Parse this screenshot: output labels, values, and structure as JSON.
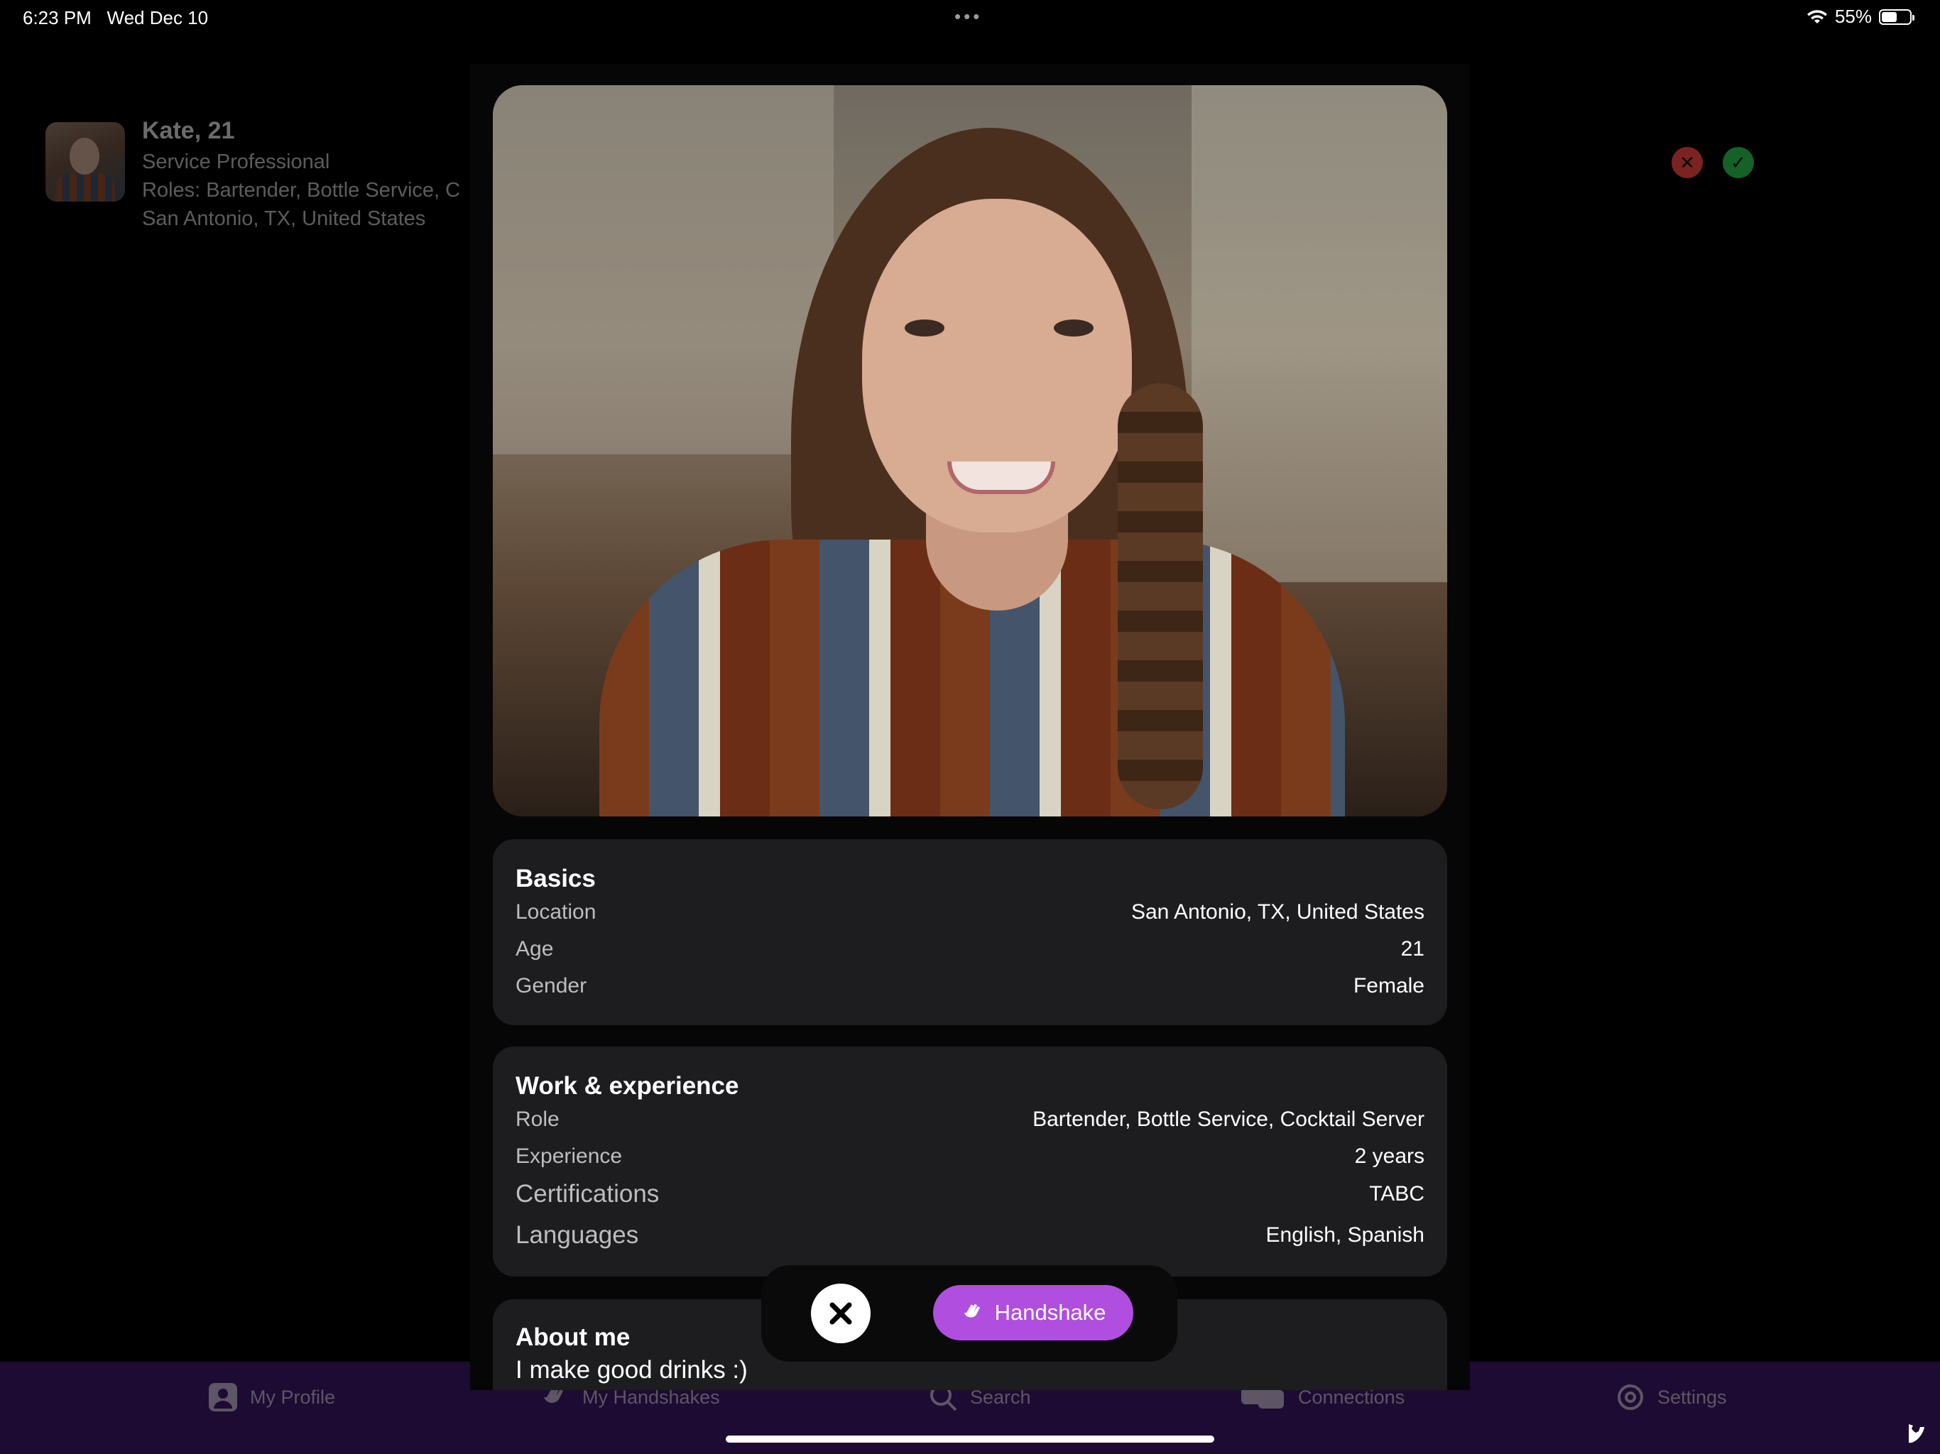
{
  "status_bar": {
    "time": "6:23 PM",
    "date": "Wed Dec 10",
    "more_dots": "•••",
    "battery_percent": "55%",
    "battery_level": 0.55
  },
  "background_list": {
    "name": "Kate, 21",
    "title": "Service Professional",
    "roles": "Roles: Bartender, Bottle Service, C",
    "location": "San Antonio, TX, United States",
    "reject_icon": "✕",
    "accept_icon": "✓"
  },
  "tabs": [
    {
      "label": "My Profile",
      "icon": "person-icon"
    },
    {
      "label": "My Handshakes",
      "icon": "wave-hand-icon"
    },
    {
      "label": "Search",
      "icon": "search-icon"
    },
    {
      "label": "Connections",
      "icon": "chat-bubbles-icon"
    },
    {
      "label": "Settings",
      "icon": "gear-icon"
    }
  ],
  "basics": {
    "title": "Basics",
    "rows": [
      {
        "key": "Location",
        "value": "San Antonio, TX, United States"
      },
      {
        "key": "Age",
        "value": "21"
      },
      {
        "key": "Gender",
        "value": "Female"
      }
    ]
  },
  "work": {
    "title": "Work & experience",
    "rows": [
      {
        "key": "Role",
        "value": "Bartender, Bottle Service, Cocktail Server"
      },
      {
        "key": "Experience",
        "value": "2 years"
      },
      {
        "key": "Certifications",
        "value": "TABC"
      },
      {
        "key": "Languages",
        "value": "English, Spanish"
      }
    ]
  },
  "about": {
    "title": "About me",
    "text": "I make good drinks :)"
  },
  "actions": {
    "handshake_label": "Handshake",
    "close_icon": "close-icon",
    "handshake_color": "#b04ee0"
  }
}
